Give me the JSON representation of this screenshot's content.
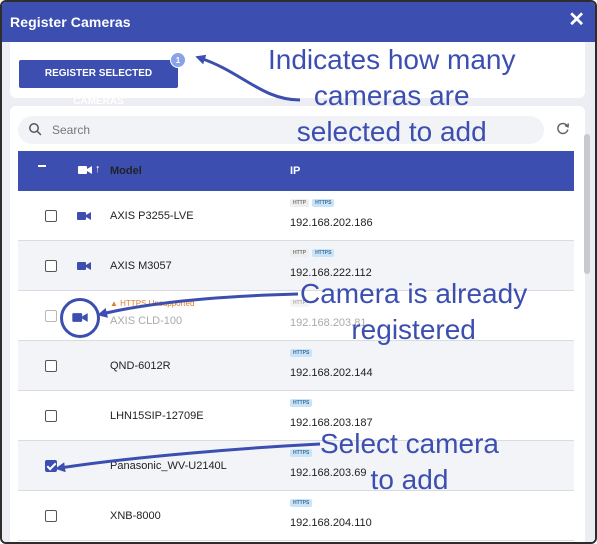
{
  "dialog": {
    "title": "Register Cameras",
    "close_symbol": "✕"
  },
  "toolbar": {
    "register_label": "REGISTER SELECTED CAMERAS",
    "selected_count": "1"
  },
  "search": {
    "placeholder": "Search"
  },
  "table": {
    "headers": {
      "model": "Model",
      "ip": "IP"
    },
    "rows": [
      {
        "model": "AXIS P3255-LVE",
        "tags": [
          "HTTP",
          "HTTPS"
        ],
        "ip": "192.168.202.186",
        "has_camera_icon": true,
        "checked": false,
        "registered": false
      },
      {
        "model": "AXIS M3057",
        "tags": [
          "HTTP",
          "HTTPS"
        ],
        "ip": "192.168.222.112",
        "has_camera_icon": true,
        "checked": false,
        "registered": false
      },
      {
        "model": "AXIS CLD-100",
        "tags": [
          "HTTP"
        ],
        "ip": "192.168.203.81",
        "has_camera_icon": true,
        "checked": false,
        "registered": true,
        "warning": "HTTPS Unsupported"
      },
      {
        "model": "QND-6012R",
        "tags": [
          "HTTPS"
        ],
        "ip": "192.168.202.144",
        "has_camera_icon": false,
        "checked": false,
        "registered": false
      },
      {
        "model": "LHN15SIP-12709E",
        "tags": [
          "HTTPS"
        ],
        "ip": "192.168.203.187",
        "has_camera_icon": false,
        "checked": false,
        "registered": false
      },
      {
        "model": "Panasonic_WV-U2140L",
        "tags": [
          "HTTPS"
        ],
        "ip": "192.168.203.69",
        "has_camera_icon": false,
        "checked": true,
        "registered": false
      },
      {
        "model": "XNB-8000",
        "tags": [
          "HTTPS"
        ],
        "ip": "192.168.204.110",
        "has_camera_icon": false,
        "checked": false,
        "registered": false
      }
    ]
  },
  "annotations": {
    "selected_count_note": [
      "Indicates how many",
      "cameras are",
      "selected to add"
    ],
    "registered_note": [
      "Camera is already",
      "registered"
    ],
    "select_note": [
      "Select camera",
      "to add"
    ]
  },
  "colors": {
    "accent": "#3c4fb0",
    "warning": "#e07a2a",
    "https_tag": "#c9e3f7"
  }
}
